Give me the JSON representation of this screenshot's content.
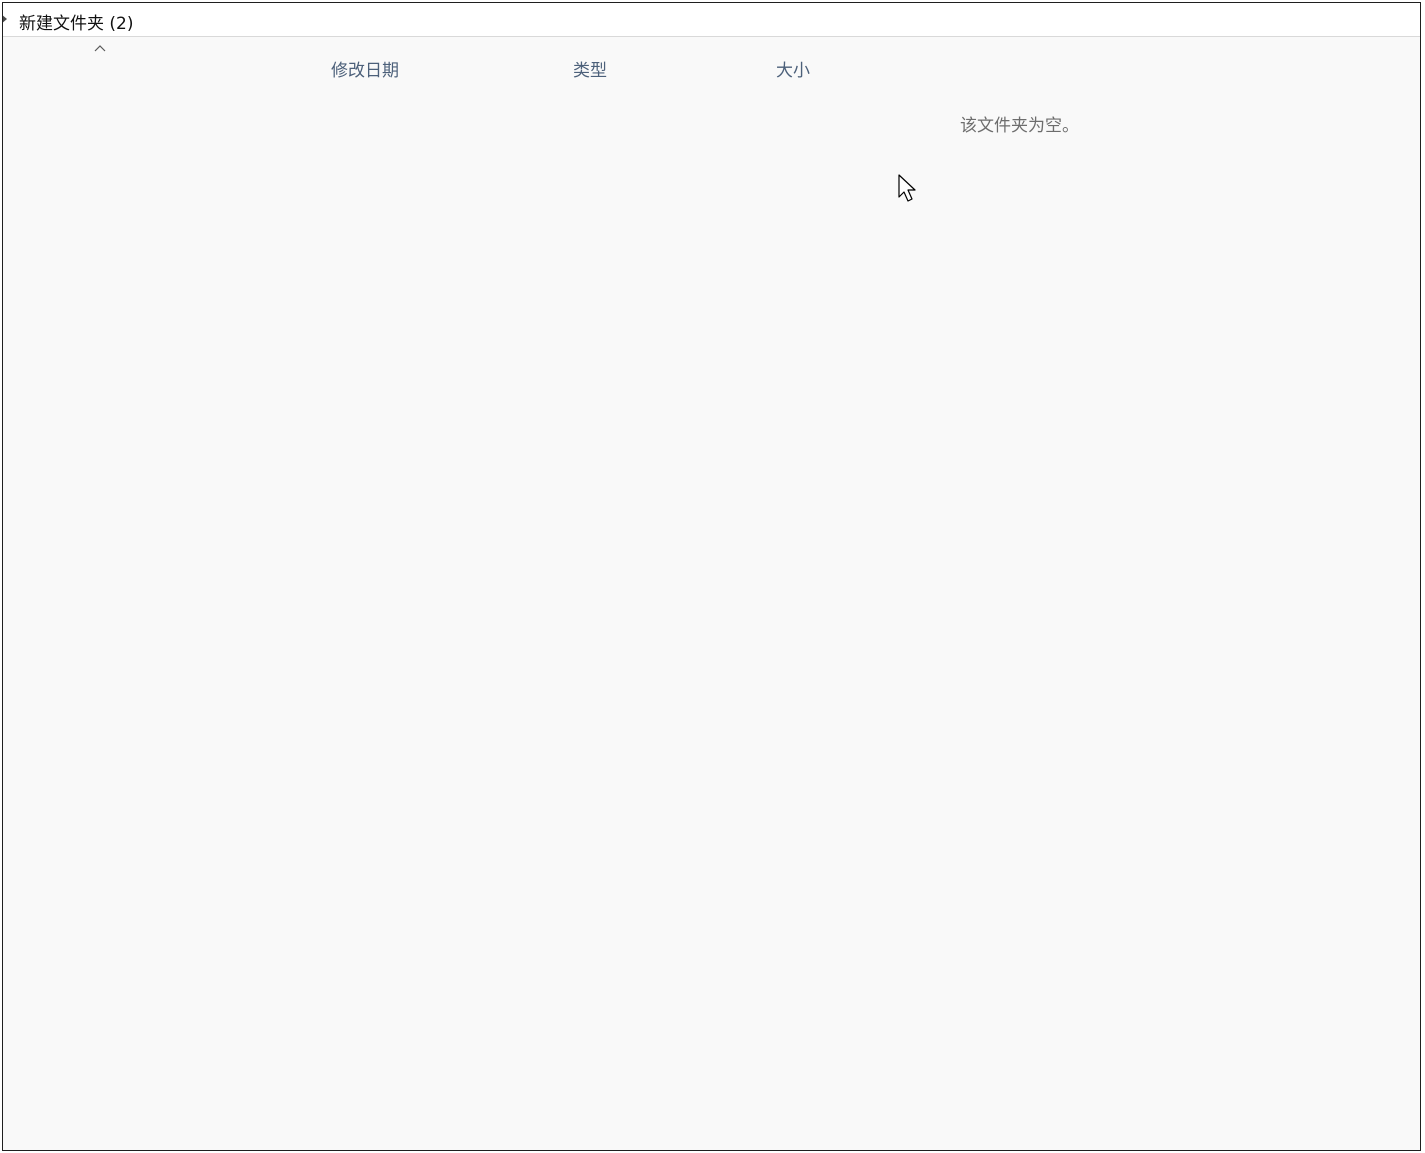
{
  "window": {
    "title": "新建文件夹 (2)"
  },
  "columns": {
    "date_modified": "修改日期",
    "type": "类型",
    "size": "大小"
  },
  "content": {
    "empty_message": "该文件夹为空。"
  },
  "icons": {
    "expand": "chevron-right-icon",
    "sort": "caret-up-icon",
    "cursor": "mouse-pointer-icon"
  },
  "colors": {
    "header_text": "#4c607a",
    "empty_text": "#6d6d6d",
    "background": "#f9f9f9"
  }
}
